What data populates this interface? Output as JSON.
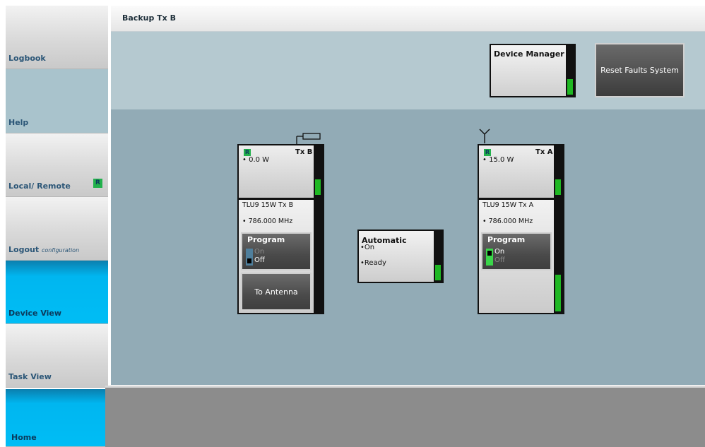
{
  "title": "Backup Tx B",
  "sidebar": {
    "items": [
      {
        "label": "Logbook"
      },
      {
        "label": "Help"
      },
      {
        "label": "Local/ Remote",
        "badge": "R"
      },
      {
        "label": "Logout",
        "sublabel": "configuration"
      },
      {
        "label": "Device View"
      },
      {
        "label": "Task View"
      },
      {
        "label": "Home"
      }
    ]
  },
  "device_manager": {
    "label": "Device Manager"
  },
  "reset_button": {
    "label": "Reset Faults System"
  },
  "tx_b": {
    "badge": "R",
    "name": "Tx B",
    "power": "• 0.0 W",
    "model": "TLU9 15W Tx B",
    "frequency": "• 786.000 MHz",
    "program": {
      "title": "Program",
      "on": "On",
      "off": "Off",
      "state": "off"
    },
    "antenna_button": "To Antenna",
    "icon": "dummy-load-icon"
  },
  "tx_a": {
    "badge": "R",
    "name": "Tx A",
    "power": "• 15.0 W",
    "model": "TLU9 15W Tx A",
    "frequency": "• 786.000 MHz",
    "program": {
      "title": "Program",
      "on": "On",
      "off": "Off",
      "state": "on"
    },
    "icon": "antenna-icon"
  },
  "automatic": {
    "title": "Automatic",
    "on": "•On",
    "ready": "•Ready"
  },
  "colors": {
    "status_green": "#1fb823",
    "accent_blue": "#00bdf5",
    "text_dark_blue": "#2b5677"
  }
}
